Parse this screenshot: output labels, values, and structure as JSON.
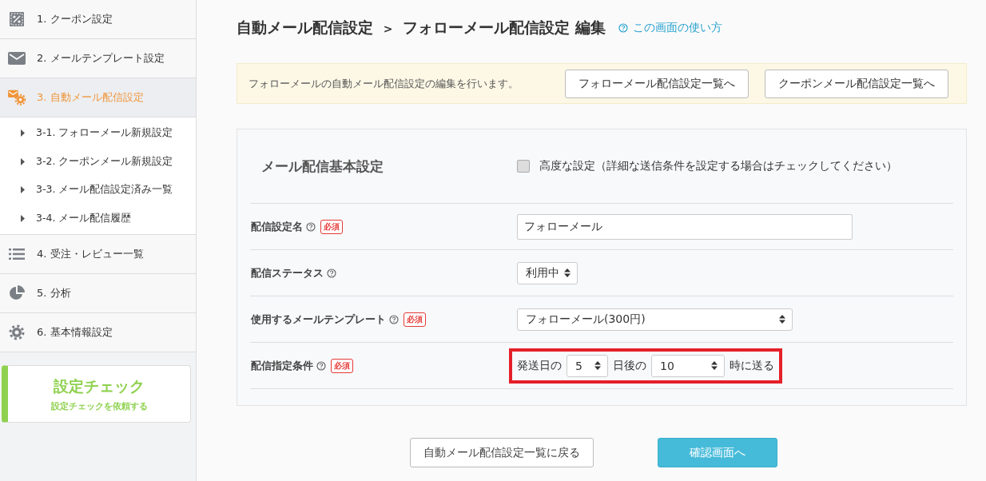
{
  "sidebar": {
    "items": [
      {
        "kind": "main",
        "label": "1. クーポン設定",
        "selected": false
      },
      {
        "kind": "main",
        "label": "2. メールテンプレート設定",
        "selected": false
      },
      {
        "kind": "main",
        "label": "3. 自動メール配信設定",
        "selected": true
      },
      {
        "kind": "sub",
        "label": "3-1. フォローメール新規設定",
        "selected": false
      },
      {
        "kind": "sub",
        "label": "3-2. クーポンメール新規設定",
        "selected": false
      },
      {
        "kind": "sub",
        "label": "3-3. メール配信設定済み一覧",
        "selected": false
      },
      {
        "kind": "sub",
        "label": "3-4. メール配信履歴",
        "selected": false
      },
      {
        "kind": "main",
        "label": "4. 受注・レビュー一覧",
        "selected": false
      },
      {
        "kind": "main",
        "label": "5. 分析",
        "selected": false
      },
      {
        "kind": "main",
        "label": "6. 基本情報設定",
        "selected": false
      }
    ],
    "check_card": {
      "title": "設定チェック",
      "subtitle": "設定チェックを依頼する"
    }
  },
  "breadcrumb": {
    "parent": "自動メール配信設定",
    "separator": ">",
    "current": "フォローメール配信設定 編集"
  },
  "help_link": "この画面の使い方",
  "notice": {
    "text": "フォローメールの自動メール配信設定の編集を行います。",
    "buttons": [
      "フォローメール配信設定一覧へ",
      "クーポンメール配信設定一覧へ"
    ]
  },
  "form": {
    "title": "メール配信基本設定",
    "advanced": {
      "label": "高度な設定（詳細な送信条件を設定する場合はチェックしてください）",
      "checked": false
    },
    "rows": [
      {
        "kind": "text",
        "label": "配信設定名",
        "required": "必須",
        "value": "フォローメール"
      },
      {
        "kind": "select",
        "label": "配信ステータス",
        "value": "利用中",
        "wide": false
      },
      {
        "kind": "select",
        "label": "使用するメールテンプレート",
        "required": "必須",
        "value": "フォローメール(300円)",
        "wide": true
      },
      {
        "kind": "condition",
        "label": "配信指定条件",
        "required": "必須",
        "prefix": "発送日の",
        "days": "5",
        "middle": "日後の",
        "hour": "10",
        "suffix": "時に送る"
      }
    ]
  },
  "footer_buttons": [
    {
      "kind": "secondary",
      "label": "自動メール配信設定一覧に戻る"
    },
    {
      "kind": "primary",
      "label": "確認画面へ"
    }
  ]
}
